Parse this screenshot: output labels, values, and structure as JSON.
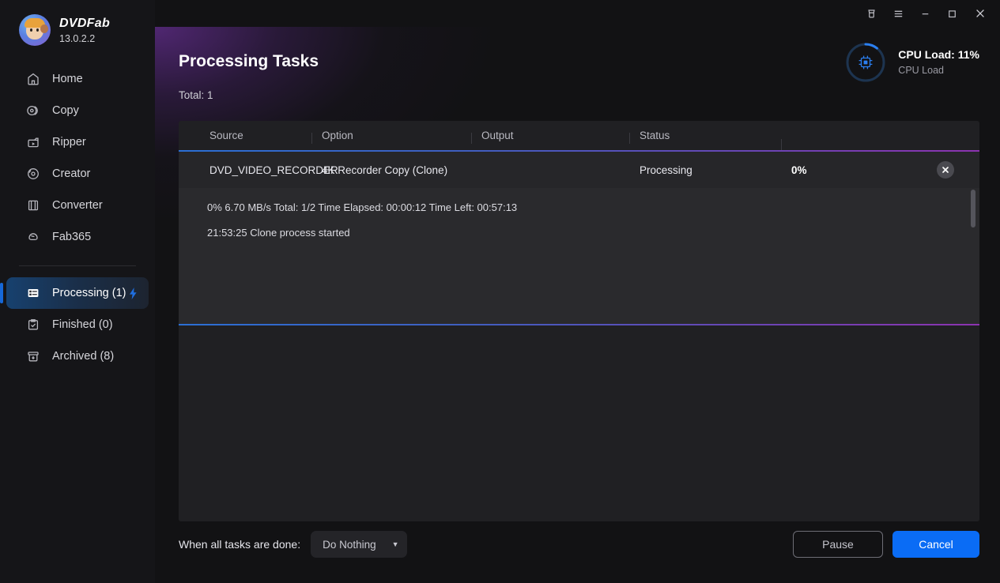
{
  "brand": {
    "name": "DVDFab",
    "version": "13.0.2.2",
    "logo_icon": "dvdfab-mascot-logo"
  },
  "titlebar": {
    "buttons": [
      {
        "name": "theme-icon",
        "label": "theme"
      },
      {
        "name": "menu-icon",
        "label": "menu"
      },
      {
        "name": "minimize-icon",
        "label": "minimize"
      },
      {
        "name": "maximize-icon",
        "label": "maximize"
      },
      {
        "name": "close-icon",
        "label": "close"
      }
    ]
  },
  "sidebar": {
    "items": [
      {
        "label": "Home",
        "icon": "home-icon",
        "active": false
      },
      {
        "label": "Copy",
        "icon": "copy-disc-icon",
        "active": false
      },
      {
        "label": "Ripper",
        "icon": "ripper-icon",
        "active": false
      },
      {
        "label": "Creator",
        "icon": "creator-disc-icon",
        "active": false
      },
      {
        "label": "Converter",
        "icon": "converter-film-icon",
        "active": false
      },
      {
        "label": "Fab365",
        "icon": "fab365-icon",
        "active": false
      }
    ],
    "task_items": [
      {
        "label": "Processing (1)",
        "icon": "processing-list-icon",
        "active": true,
        "badge_icon": "lightning-bolt-icon"
      },
      {
        "label": "Finished (0)",
        "icon": "clipboard-check-icon",
        "active": false
      },
      {
        "label": "Archived (8)",
        "icon": "archive-box-icon",
        "active": false
      }
    ]
  },
  "page": {
    "title": "Processing Tasks",
    "total": "Total: 1"
  },
  "cpu": {
    "main": "CPU Load: 11%",
    "sub": "CPU Load",
    "percent": 11,
    "ring_color": "#1a6ae0",
    "icon": "cpu-chip-icon"
  },
  "table": {
    "columns": [
      "Source",
      "Option",
      "Output",
      "Status"
    ],
    "rows": [
      {
        "source": "DVD_VIDEO_RECORDER",
        "option": "4K Recorder Copy (Clone)",
        "output": "",
        "status": "Processing",
        "percent": "0%",
        "close_icon": "cancel-task-icon"
      }
    ]
  },
  "detail": {
    "stats": "0%  6.70 MB/s   Total: 1/2  Time Elapsed: 00:00:12  Time Left: 00:57:13",
    "log": "21:53:25  Clone process started"
  },
  "bottom": {
    "when_label": "When all tasks are done:",
    "dropdown_value": "Do Nothing",
    "dropdown_caret": "▼",
    "pause_label": "Pause",
    "cancel_label": "Cancel"
  },
  "colors": {
    "accent_blue": "#0a6cf5",
    "divider_gradient_start": "#2b6fd4",
    "divider_gradient_end": "#8c33b0",
    "glow_purple": "#682f96"
  }
}
